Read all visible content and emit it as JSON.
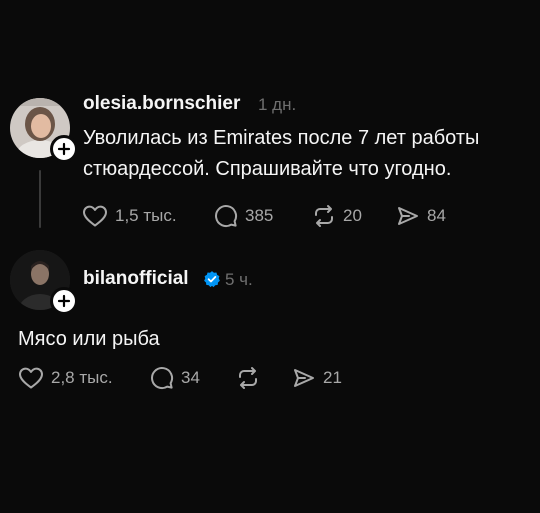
{
  "posts": [
    {
      "username": "olesia.bornschier",
      "time": "1 дн.",
      "text_lines": [
        "Уволилась из Emirates после 7 лет работы",
        "стюардессой. Спрашивайте что угодно."
      ],
      "actions": {
        "likes": "1,5 тыс.",
        "comments": "385",
        "reposts": "20",
        "shares": "84"
      }
    },
    {
      "username": "bilanofficial",
      "time": "5 ч.",
      "verified": true,
      "text": "Мясо или рыба",
      "actions": {
        "likes": "2,8 тыс.",
        "comments": "34",
        "reposts": "",
        "shares": "21"
      }
    }
  ],
  "colors": {
    "background": "#0a0a0a",
    "text": "#f5f5f5",
    "muted": "#a8a8a8",
    "verified": "#0095f6"
  },
  "icons": [
    "heart-icon",
    "comment-icon",
    "repost-icon",
    "share-icon",
    "plus-icon",
    "verified-badge-icon"
  ]
}
